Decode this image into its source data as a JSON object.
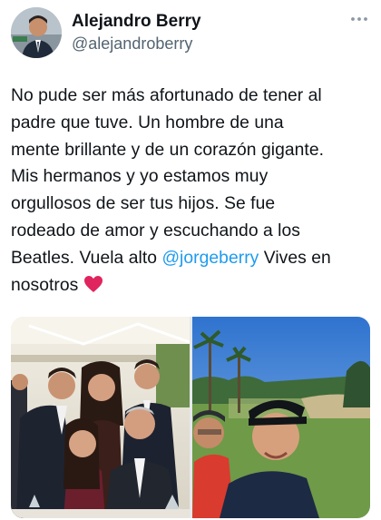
{
  "author": {
    "display_name": "Alejandro Berry",
    "handle": "@alejandroberry"
  },
  "icons": {
    "more": "more-options-icon",
    "heart": "red-heart-emoji"
  },
  "tweet": {
    "line1": "No pude ser más afortunado de tener al",
    "line2": "padre que tuve. Un hombre de una",
    "line3": "mente brillante y de un corazón gigante.",
    "line4": "Mis hermanos y yo estamos muy",
    "line5": "orgullosos de ser tus hijos. Se fue",
    "line6": "rodeado de amor y escuchando a los",
    "line7_before": "Beatles. Vuela alto ",
    "mention": "@jorgeberry",
    "line7_after": " Vives en",
    "line8": "nosotros"
  },
  "colors": {
    "link": "#1d9bf0",
    "secondary_text": "#536471",
    "heart": "#e0245e"
  }
}
